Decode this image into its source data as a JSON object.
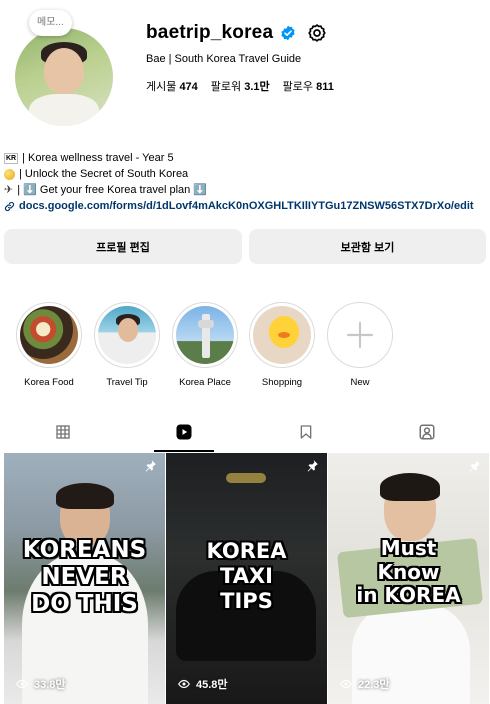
{
  "profile": {
    "note": "메모...",
    "username": "baetrip_korea",
    "fullname": "Bae | South Korea Travel Guide",
    "stats": {
      "posts_label": "게시물",
      "posts_value": "474",
      "followers_label": "팔로워",
      "followers_value": "3.1만",
      "following_label": "팔로우",
      "following_value": "811"
    },
    "bio": {
      "line1_flag": "KR",
      "line1_text": "| Korea wellness travel - Year 5",
      "line2_text": "| Unlock the Secret of South Korea",
      "line3_text": "| ⬇️ Get your free Korea travel plan ⬇️",
      "link": "docs.google.com/forms/d/1dLovf4mAkcK0nOXGHLTKIlIYTGu17ZNSW56STX7DrXo/edit"
    }
  },
  "buttons": {
    "edit": "프로필 편집",
    "archive": "보관함 보기"
  },
  "highlights": [
    {
      "label": "Korea Food"
    },
    {
      "label": "Travel Tip"
    },
    {
      "label": "Korea Place"
    },
    {
      "label": "Shopping"
    },
    {
      "label": "New"
    }
  ],
  "tabs": [
    "grid",
    "reels",
    "saved",
    "tagged"
  ],
  "reels": [
    {
      "lines": [
        "KOREANS",
        "NEVER",
        "DO THIS"
      ],
      "views": "33.8만"
    },
    {
      "lines": [
        "KOREA",
        "TAXI",
        "TIPS"
      ],
      "views": "45.8만"
    },
    {
      "lines": [
        "Must",
        "Know",
        "in KOREA"
      ],
      "views": "22.3만"
    }
  ],
  "colors": {
    "verified": "#0095f6",
    "link": "#00376b",
    "button_bg": "#efefef"
  },
  "icons": {
    "verified": "verified-badge-icon",
    "settings": "settings-gear-icon",
    "pin": "pin-icon",
    "views": "eye-icon"
  }
}
